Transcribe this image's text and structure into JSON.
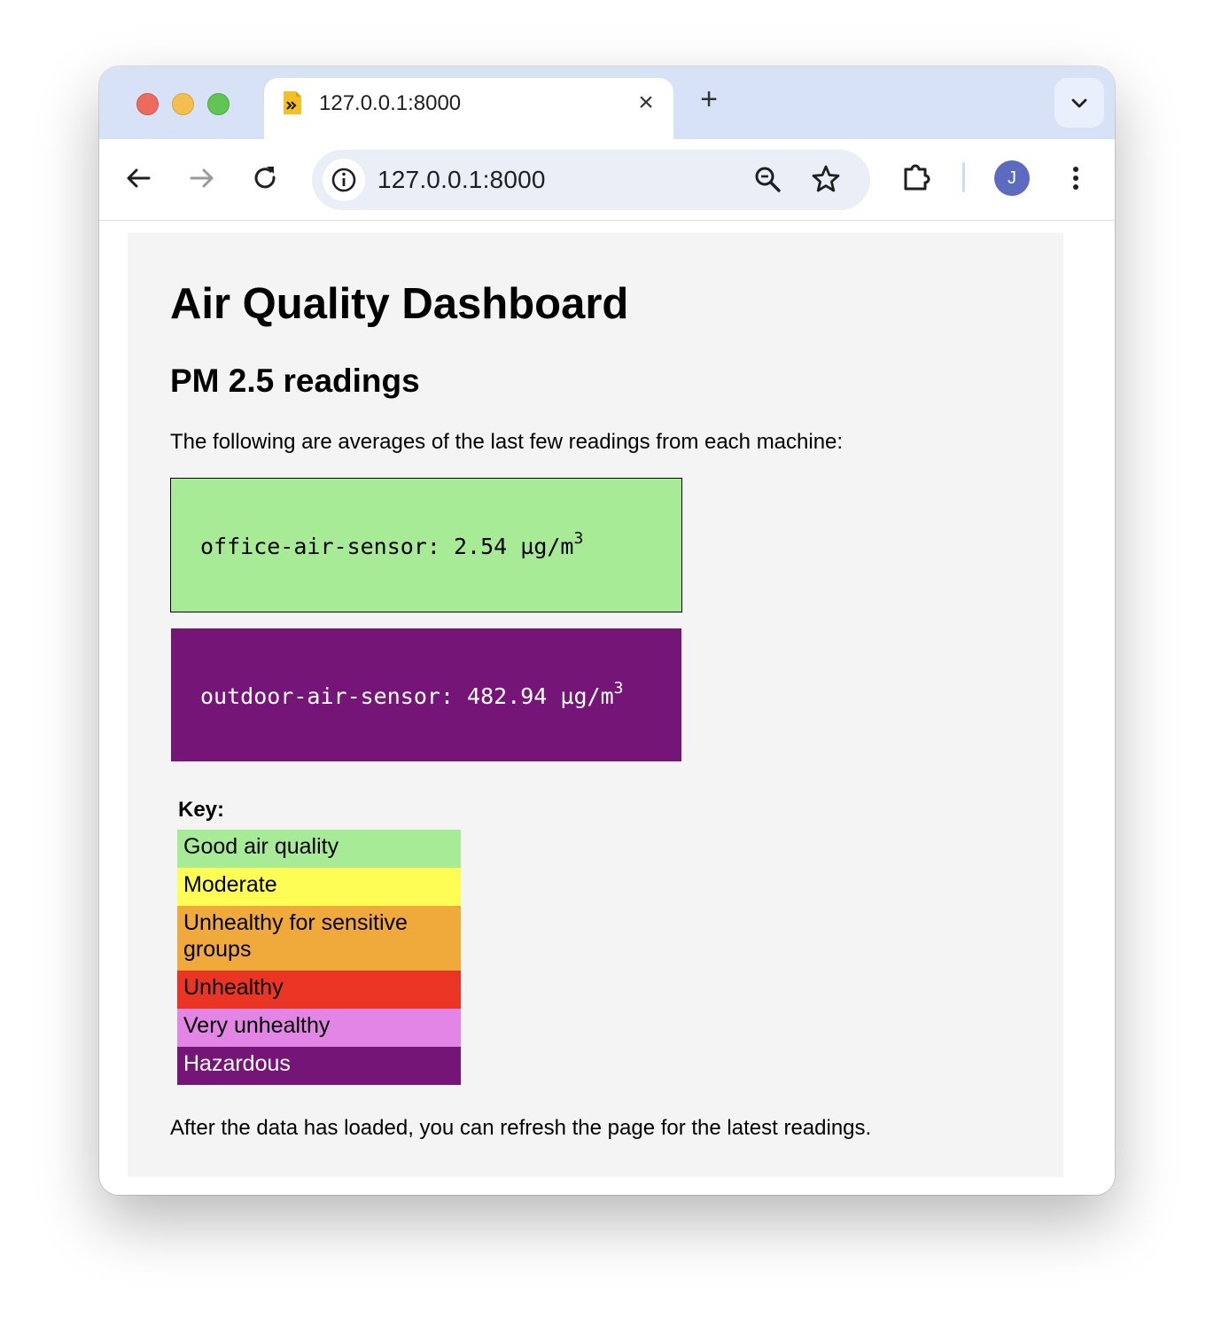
{
  "browser": {
    "tab": {
      "title": "127.0.0.1:8000"
    },
    "omnibox": {
      "url": "127.0.0.1:8000"
    },
    "profile_initial": "J"
  },
  "page": {
    "title": "Air Quality Dashboard",
    "subtitle": "PM 2.5 readings",
    "intro": "The following are averages of the last few readings from each machine:",
    "readings": [
      {
        "sensor": "office-air-sensor",
        "value": "2.54",
        "unit": "µg/m",
        "unit_exponent": "3",
        "category": "Good air quality",
        "color": "#a8eb97"
      },
      {
        "sensor": "outdoor-air-sensor",
        "value": "482.94",
        "unit": "µg/m",
        "unit_exponent": "3",
        "category": "Hazardous",
        "color": "#761578"
      }
    ],
    "key": {
      "label": "Key:",
      "items": [
        {
          "label": "Good air quality",
          "color": "#a8eb97"
        },
        {
          "label": "Moderate",
          "color": "#fdfd55"
        },
        {
          "label": "Unhealthy for sensitive groups",
          "color": "#f0a93b"
        },
        {
          "label": "Unhealthy",
          "color": "#ea3524"
        },
        {
          "label": "Very unhealthy",
          "color": "#e285e5"
        },
        {
          "label": "Hazardous",
          "color": "#761578"
        }
      ]
    },
    "footer": "After the data has loaded, you can refresh the page for the latest readings."
  }
}
